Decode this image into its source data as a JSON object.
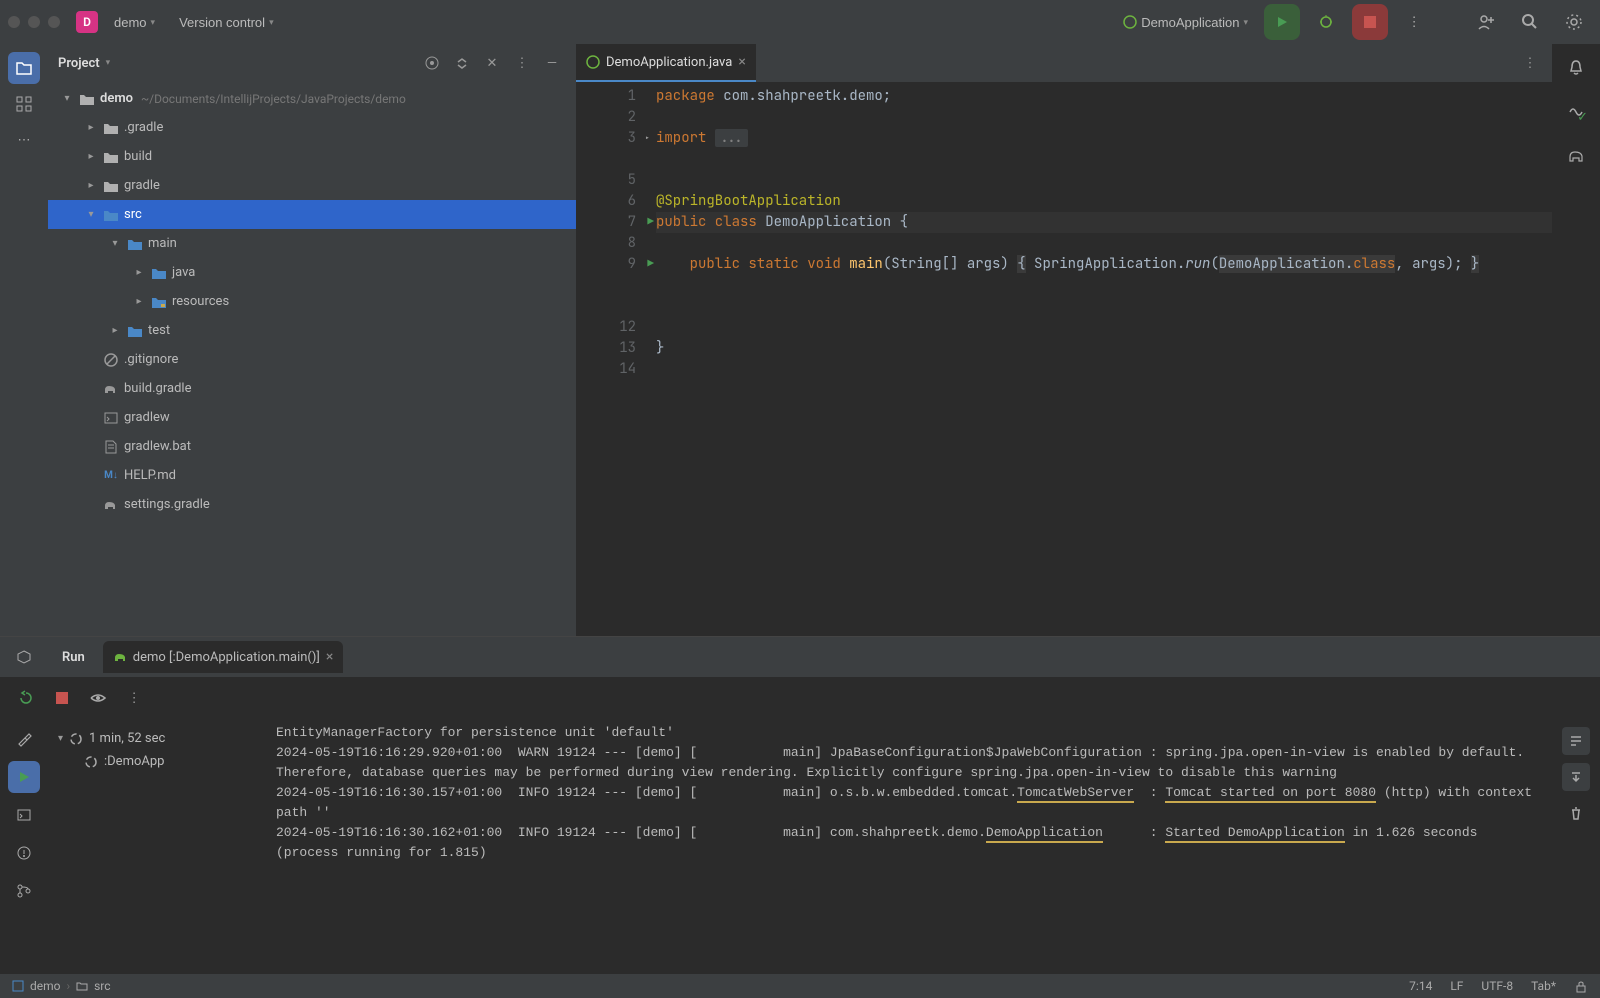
{
  "topbar": {
    "project_badge": "D",
    "project_name": "demo",
    "version_control": "Version control",
    "run_config": "DemoApplication"
  },
  "project_panel": {
    "title": "Project",
    "root": {
      "name": "demo",
      "path": "~/Documents/IntellijProjects/JavaProjects/demo"
    },
    "items": [
      {
        "label": ".gradle",
        "indent": 1,
        "type": "folder",
        "expand": "right"
      },
      {
        "label": "build",
        "indent": 1,
        "type": "folder",
        "expand": "right"
      },
      {
        "label": "gradle",
        "indent": 1,
        "type": "folder",
        "expand": "right"
      },
      {
        "label": "src",
        "indent": 1,
        "type": "folder-blue",
        "expand": "down",
        "selected": true
      },
      {
        "label": "main",
        "indent": 2,
        "type": "folder-blue",
        "expand": "down"
      },
      {
        "label": "java",
        "indent": 3,
        "type": "folder-blue",
        "expand": "right"
      },
      {
        "label": "resources",
        "indent": 3,
        "type": "folder-res",
        "expand": "right"
      },
      {
        "label": "test",
        "indent": 2,
        "type": "folder-blue",
        "expand": "right"
      },
      {
        "label": ".gitignore",
        "indent": 1,
        "type": "gitignore",
        "expand": "none"
      },
      {
        "label": "build.gradle",
        "indent": 1,
        "type": "gradle",
        "expand": "none"
      },
      {
        "label": "gradlew",
        "indent": 1,
        "type": "shell",
        "expand": "none"
      },
      {
        "label": "gradlew.bat",
        "indent": 1,
        "type": "file",
        "expand": "none"
      },
      {
        "label": "HELP.md",
        "indent": 1,
        "type": "md",
        "expand": "none"
      },
      {
        "label": "settings.gradle",
        "indent": 1,
        "type": "gradle",
        "expand": "none"
      }
    ]
  },
  "editor": {
    "tab_name": "DemoApplication.java",
    "lines": [
      "package com.shahpreetk.demo;",
      "",
      "import ...",
      "",
      "",
      "@SpringBootApplication",
      "public class DemoApplication {",
      "",
      "    public static void main(String[] args) { SpringApplication.run(DemoApplication.class, args); }",
      "",
      "",
      "",
      "}",
      ""
    ],
    "line_numbers": [
      "1",
      "2",
      "3",
      "",
      "5",
      "6",
      "7",
      "8",
      "9",
      "",
      "",
      "12",
      "13",
      "14"
    ]
  },
  "run": {
    "label": "Run",
    "config": "demo [:DemoApplication.main()]",
    "duration": "1 min, 52 sec",
    "task": ":DemoApp",
    "console": [
      "EntityManagerFactory for persistence unit 'default'",
      "2024-05-19T16:16:29.920+01:00  WARN 19124 --- [demo] [           main] JpaBaseConfiguration$JpaWebConfiguration : spring.jpa.open-in-view is enabled by default. Therefore, database queries may be performed during view rendering. Explicitly configure spring.jpa.open-in-view to disable this warning",
      "2024-05-19T16:16:30.157+01:00  INFO 19124 --- [demo] [           main] o.s.b.w.embedded.tomcat.TomcatWebServer  : Tomcat started on port 8080 (http) with context path ''",
      "2024-05-19T16:16:30.162+01:00  INFO 19124 --- [demo] [           main] com.shahpreetk.demo.DemoApplication      : Started DemoApplication in 1.626 seconds (process running for 1.815)"
    ]
  },
  "status": {
    "breadcrumb_root": "demo",
    "breadcrumb_leaf": "src",
    "cursor": "7:14",
    "line_sep": "LF",
    "encoding": "UTF-8",
    "indent": "Tab*"
  }
}
